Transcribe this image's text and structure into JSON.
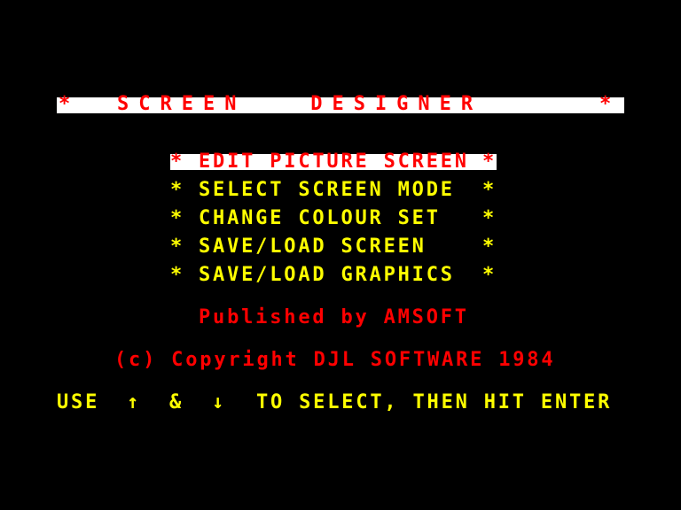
{
  "app": {
    "title": "SCREEN   DESIGNER",
    "title_star": "*"
  },
  "menu": {
    "selected_index": 0,
    "star": "*",
    "items": [
      {
        "label": "EDIT PICTURE SCREEN"
      },
      {
        "label": "SELECT SCREEN MODE"
      },
      {
        "label": "CHANGE COLOUR SET"
      },
      {
        "label": "SAVE/LOAD SCREEN"
      },
      {
        "label": "SAVE/LOAD GRAPHICS"
      }
    ]
  },
  "credits": {
    "publisher": "Published by AMSOFT",
    "copyright": "(c) Copyright DJL SOFTWARE 1984"
  },
  "instructions": {
    "use": "USE",
    "up_arrow": "↑",
    "and": "&",
    "down_arrow": "↓",
    "rest": "TO SELECT, THEN HIT ENTER"
  },
  "colors": {
    "background": "#000000",
    "title_text": "#ff0000",
    "highlight_bg": "#ffffff",
    "menu_text": "#ffff00",
    "credits_text": "#ff0000"
  }
}
